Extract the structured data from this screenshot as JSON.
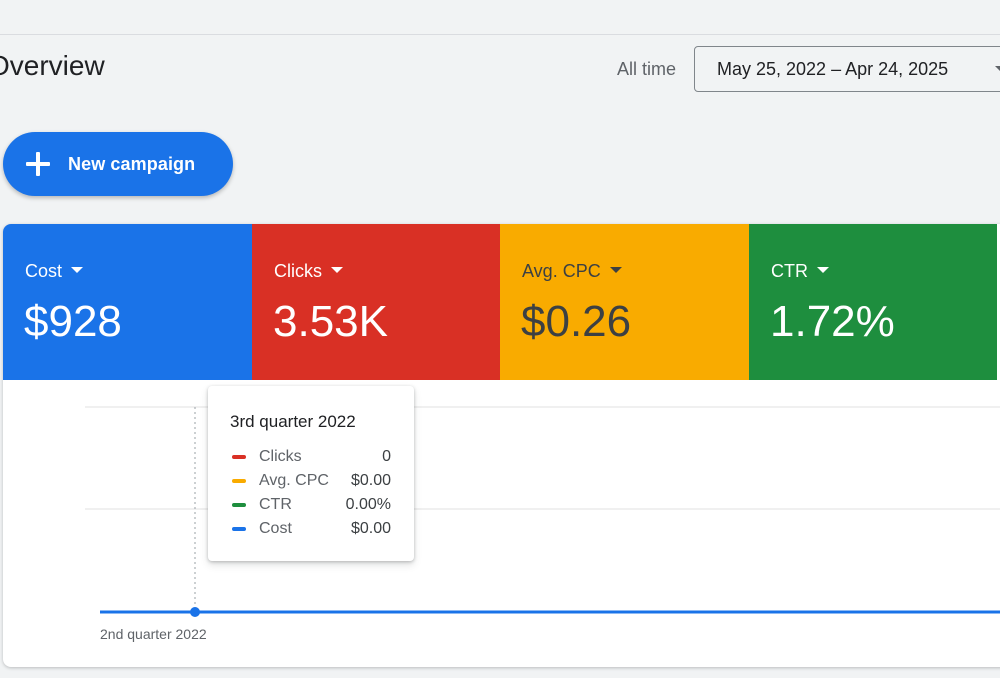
{
  "header": {
    "title": "Overview",
    "range_label": "All time",
    "date_range": "May 25, 2022 – Apr 24, 2025"
  },
  "actions": {
    "new_campaign_label": "New campaign"
  },
  "metrics": [
    {
      "label": "Cost",
      "value": "$928",
      "color": "#1a73e8"
    },
    {
      "label": "Clicks",
      "value": "3.53K",
      "color": "#d93025"
    },
    {
      "label": "Avg. CPC",
      "value": "$0.26",
      "color": "#f9ab00"
    },
    {
      "label": "CTR",
      "value": "1.72%",
      "color": "#1e8e3e"
    }
  ],
  "tooltip": {
    "title": "3rd quarter 2022",
    "rows": [
      {
        "name": "Clicks",
        "value": "0",
        "color": "#d93025"
      },
      {
        "name": "Avg. CPC",
        "value": "$0.00",
        "color": "#f9ab00"
      },
      {
        "name": "CTR",
        "value": "0.00%",
        "color": "#1e8e3e"
      },
      {
        "name": "Cost",
        "value": "$0.00",
        "color": "#1a73e8"
      }
    ]
  },
  "chart_data": {
    "type": "line",
    "x": [
      "2nd quarter 2022",
      "3rd quarter 2022"
    ],
    "series": [
      {
        "name": "Cost",
        "values": [
          0,
          0
        ],
        "color": "#1a73e8"
      }
    ],
    "highlighted_category": "3rd quarter 2022",
    "grid": true,
    "tick_labels": [
      "2nd quarter 2022"
    ]
  }
}
